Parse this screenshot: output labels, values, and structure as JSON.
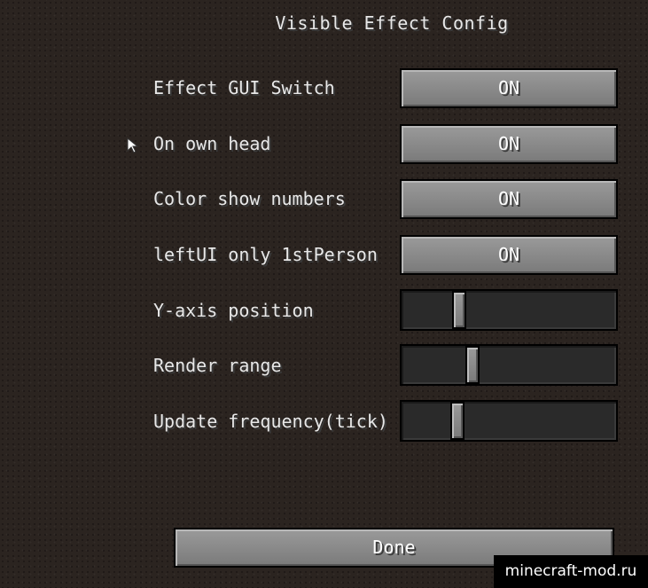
{
  "screen": {
    "title": "Visible Effect Config"
  },
  "options": [
    {
      "label": "Effect GUI Switch",
      "value": "ON"
    },
    {
      "label": "On own head",
      "value": "ON"
    },
    {
      "label": "Color show numbers",
      "value": "ON"
    },
    {
      "label": "leftUI only 1stPerson",
      "value": "ON"
    }
  ],
  "sliders": [
    {
      "label": "Y-axis position",
      "level": 0.27
    },
    {
      "label": "Render range",
      "level": 0.33
    },
    {
      "label": "Update frequency(tick)",
      "level": 0.26
    }
  ],
  "done_label": "Done",
  "watermark": "minecraft-mod.ru",
  "icons": {
    "pointer": "mouse-pointer-icon"
  }
}
